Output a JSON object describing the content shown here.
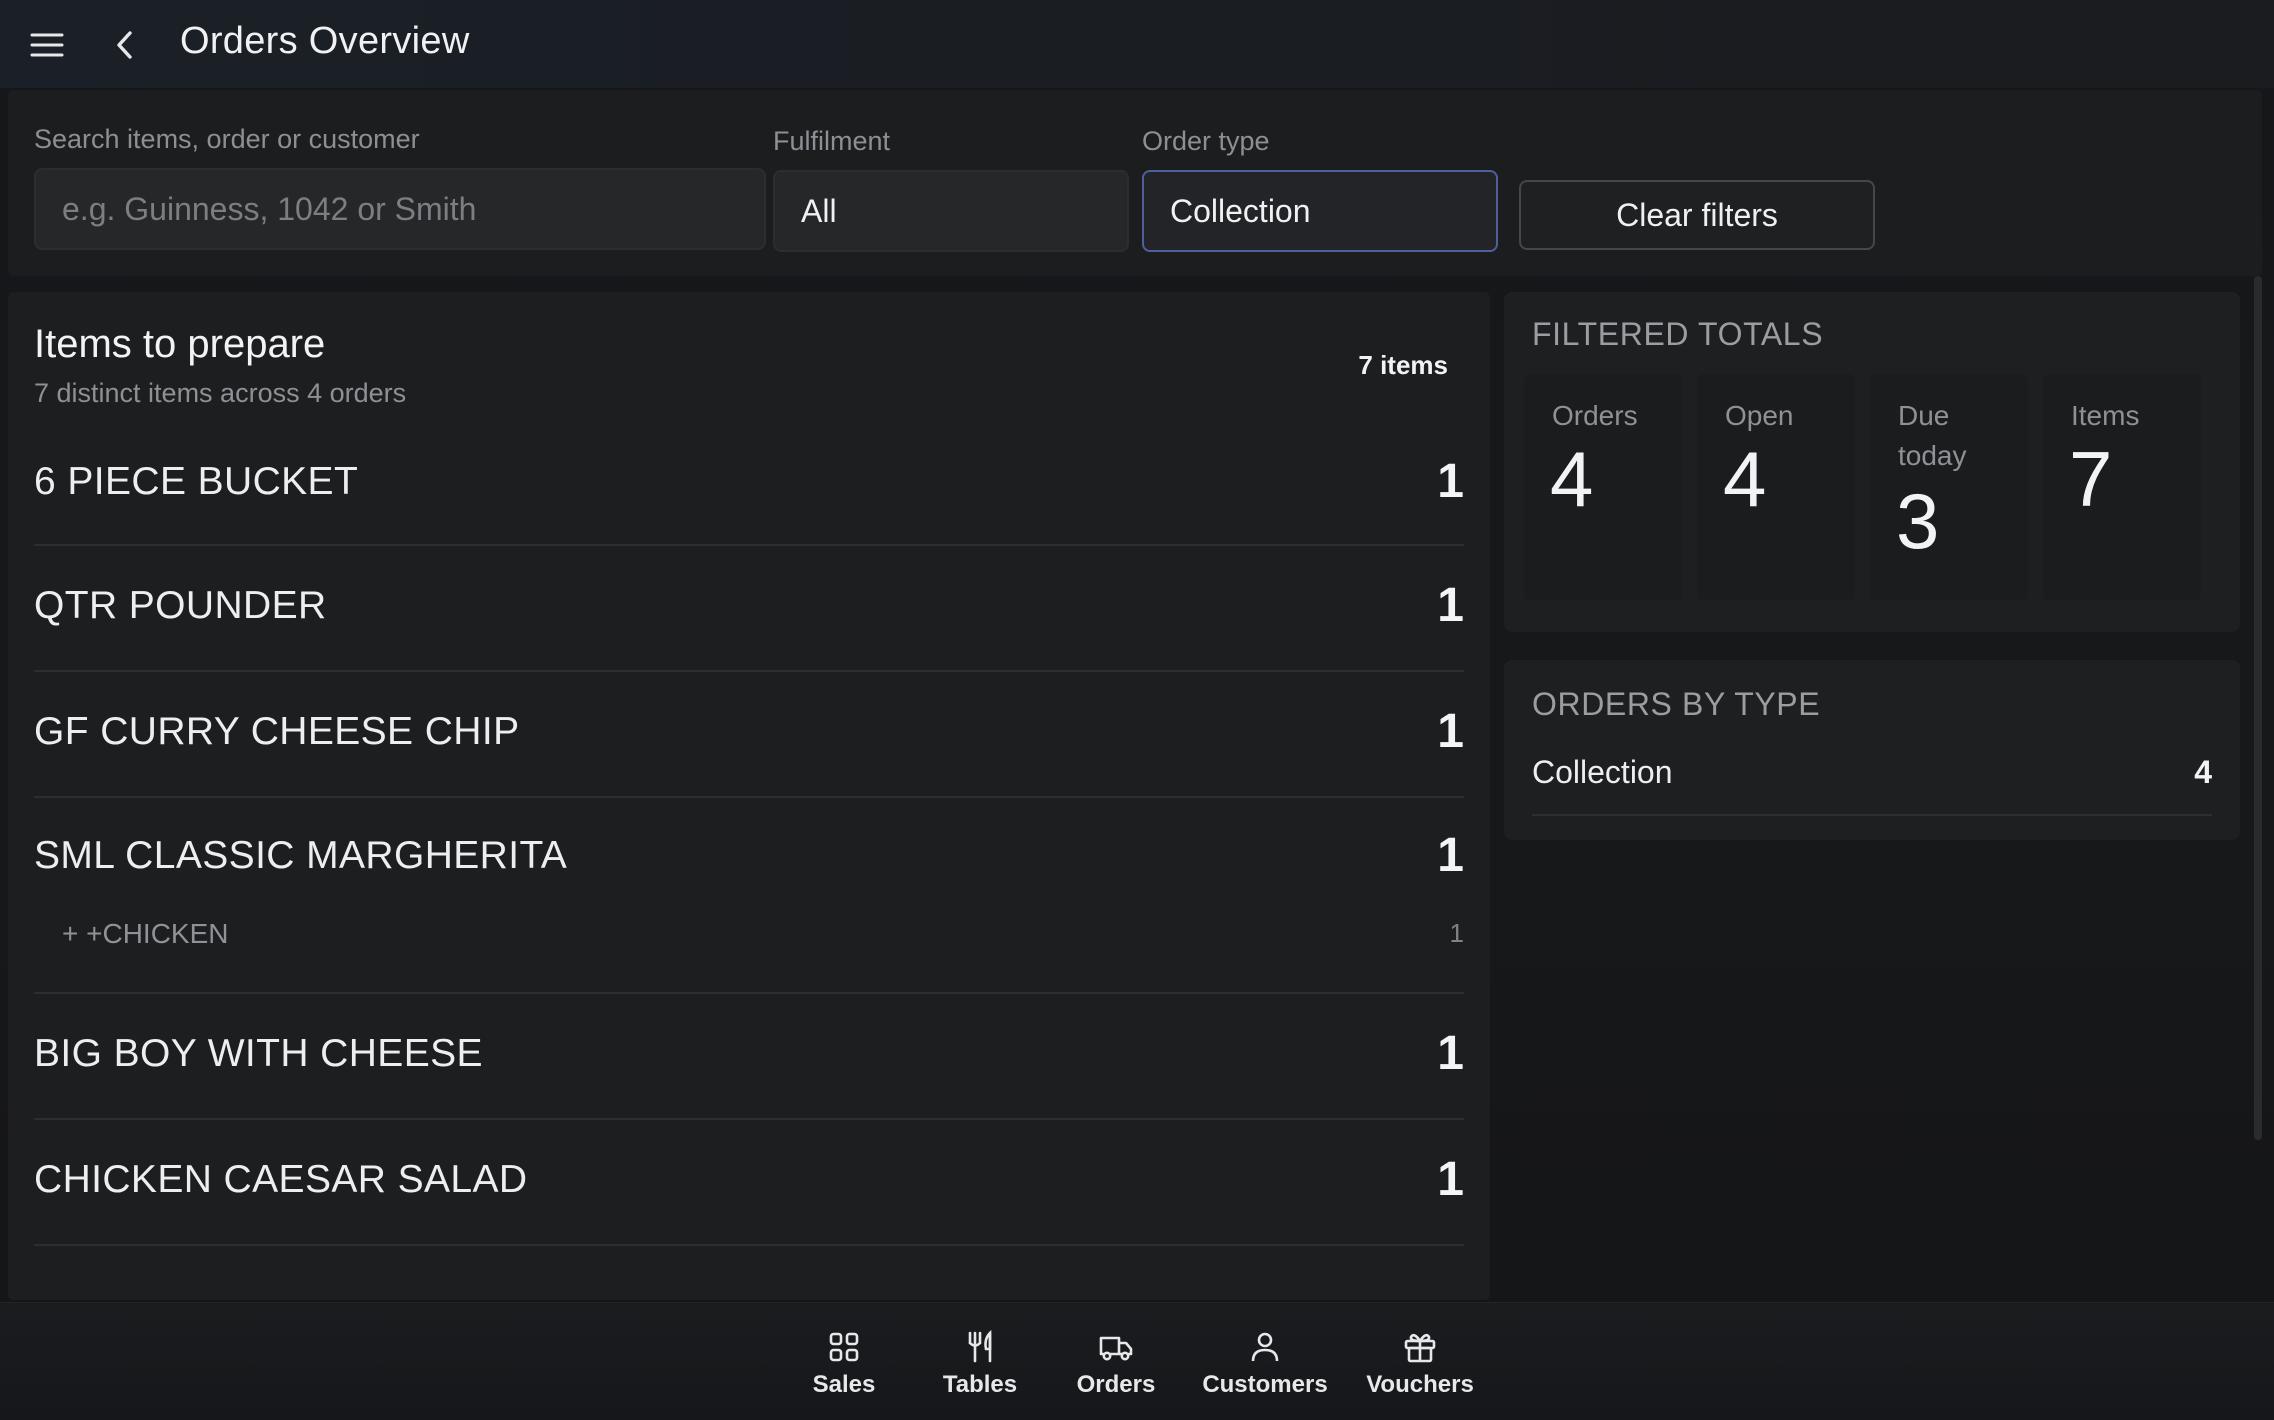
{
  "header": {
    "title": "Orders Overview",
    "menu_icon": "hamburger-menu-icon",
    "back_icon": "chevron-left-icon"
  },
  "filters": {
    "search": {
      "label": "Search items, order or customer",
      "placeholder": "e.g. Guinness, 1042 or Smith",
      "value": ""
    },
    "fulfilment": {
      "label": "Fulfilment",
      "value": "All"
    },
    "order_type": {
      "label": "Order type",
      "value": "Collection"
    },
    "clear_label": "Clear filters"
  },
  "items_panel": {
    "title": "Items to prepare",
    "subtitle": "7 distinct items across 4 orders",
    "count_badge": "7 items",
    "items": [
      {
        "name": "6 PIECE BUCKET",
        "qty": "1"
      },
      {
        "name": "QTR POUNDER",
        "qty": "1"
      },
      {
        "name": "GF CURRY CHEESE CHIP",
        "qty": "1"
      },
      {
        "name": "SML CLASSIC MARGHERITA",
        "qty": "1",
        "modifier": {
          "name": "+ +CHICKEN",
          "qty": "1"
        }
      },
      {
        "name": "BIG BOY WITH CHEESE",
        "qty": "1"
      },
      {
        "name": "CHICKEN CAESAR SALAD",
        "qty": "1"
      }
    ]
  },
  "filtered_totals": {
    "title": "FILTERED TOTALS",
    "stats": [
      {
        "label": "Orders",
        "value": "4"
      },
      {
        "label": "Open",
        "value": "4"
      },
      {
        "label": "Due today",
        "value": "3"
      },
      {
        "label": "Items",
        "value": "7"
      }
    ]
  },
  "orders_by_type": {
    "title": "ORDERS BY TYPE",
    "rows": [
      {
        "type": "Collection",
        "count": "4"
      }
    ]
  },
  "bottom_nav": {
    "items": [
      {
        "label": "Sales",
        "icon": "grid-icon"
      },
      {
        "label": "Tables",
        "icon": "fork-knife-icon"
      },
      {
        "label": "Orders",
        "icon": "delivery-truck-icon"
      },
      {
        "label": "Customers",
        "icon": "person-icon"
      },
      {
        "label": "Vouchers",
        "icon": "gift-icon"
      }
    ]
  },
  "colors": {
    "background": "#161718",
    "panel": "#1d1e20",
    "active_border": "#4f5f9c",
    "text": "#e9eaec",
    "muted_text": "#8c8f94"
  }
}
